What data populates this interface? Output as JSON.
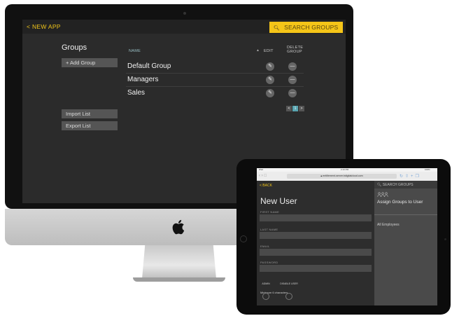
{
  "desktop": {
    "nav": {
      "back_label": "NEW APP"
    },
    "search": {
      "placeholder": "SEARCH GROUPS"
    },
    "sidebar": {
      "title": "Groups",
      "add_label": "+ Add Group",
      "import_label": "Import List",
      "export_label": "Export List"
    },
    "table": {
      "headers": {
        "name": "NAME",
        "edit": "EDIT",
        "delete": "DELETE GROUP"
      },
      "rows": [
        {
          "name": "Default Group"
        },
        {
          "name": "Managers"
        },
        {
          "name": "Sales"
        }
      ]
    },
    "pager": {
      "prev": "<",
      "current": "1",
      "next": ">"
    }
  },
  "tablet": {
    "status_bar": {
      "carrier": "iPad",
      "time": "2:13 PM",
      "battery": "100%"
    },
    "browser": {
      "url": "entitlement-server.bdigitalcloud.com"
    },
    "nav": {
      "back_label": "< BACK"
    },
    "form": {
      "title": "New User",
      "first_name_label": "FIRST NAME",
      "last_name_label": "LAST NAME",
      "email_label": "EMAIL",
      "password_label": "PASSWORD",
      "password_hint": "Minimum 6 characters",
      "admin_label": "ADMIN",
      "disable_label": "DISABLE USER"
    },
    "right_panel": {
      "search_placeholder": "SEARCH GROUPS",
      "assign_title": "Assign Groups to User",
      "items": [
        "All Employees"
      ]
    }
  },
  "colors": {
    "accent": "#f0c419",
    "search_bg": "#f5c518",
    "pager_active": "#5aa5b0"
  }
}
